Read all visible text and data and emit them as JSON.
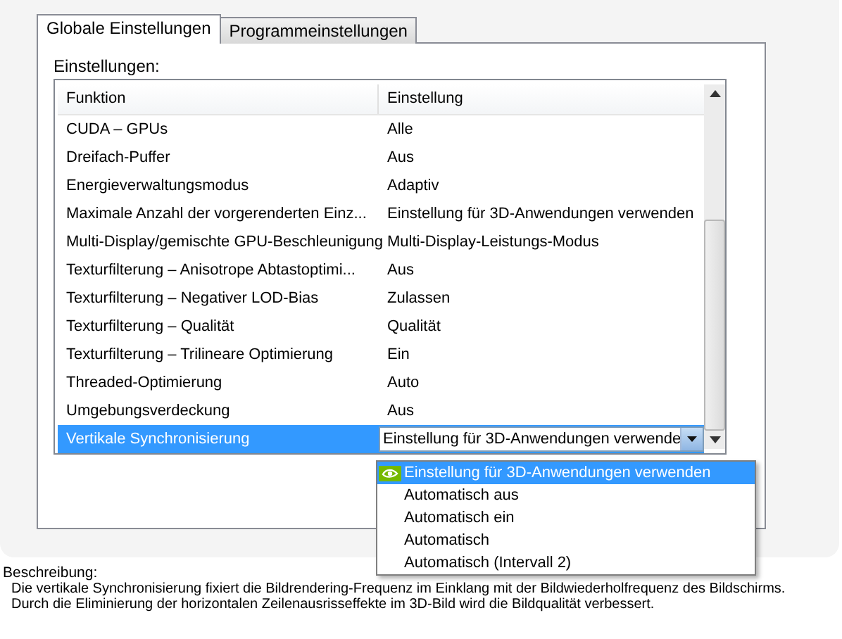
{
  "tabs": [
    {
      "label": "Globale Einstellungen",
      "selected": true
    },
    {
      "label": "Programmeinstellungen",
      "selected": false
    }
  ],
  "settings_label": "Einstellungen:",
  "table": {
    "columns": [
      "Funktion",
      "Einstellung"
    ],
    "rows": [
      {
        "function": "CUDA – GPUs",
        "setting": "Alle",
        "selected": false
      },
      {
        "function": "Dreifach-Puffer",
        "setting": "Aus",
        "selected": false
      },
      {
        "function": "Energieverwaltungsmodus",
        "setting": "Adaptiv",
        "selected": false
      },
      {
        "function": "Maximale Anzahl der vorgerenderten Einz...",
        "setting": "Einstellung für 3D-Anwendungen verwenden",
        "selected": false
      },
      {
        "function": "Multi-Display/gemischte GPU-Beschleunigung",
        "setting": "Multi-Display-Leistungs-Modus",
        "selected": false
      },
      {
        "function": "Texturfilterung – Anisotrope Abtastoptimi...",
        "setting": "Aus",
        "selected": false
      },
      {
        "function": "Texturfilterung – Negativer LOD-Bias",
        "setting": "Zulassen",
        "selected": false
      },
      {
        "function": "Texturfilterung – Qualität",
        "setting": "Qualität",
        "selected": false
      },
      {
        "function": "Texturfilterung – Trilineare Optimierung",
        "setting": "Ein",
        "selected": false
      },
      {
        "function": "Threaded-Optimierung",
        "setting": "Auto",
        "selected": false
      },
      {
        "function": "Umgebungsverdeckung",
        "setting": "Aus",
        "selected": false
      },
      {
        "function": "Vertikale Synchronisierung",
        "setting": "Einstellung für 3D-Anwendungen verwende",
        "selected": true
      }
    ]
  },
  "dropdown": {
    "expanded": true,
    "options": [
      {
        "label": "Einstellung für 3D-Anwendungen verwenden",
        "selected": true,
        "recommended": true
      },
      {
        "label": "Automatisch aus",
        "selected": false,
        "recommended": false
      },
      {
        "label": "Automatisch ein",
        "selected": false,
        "recommended": false
      },
      {
        "label": "Automatisch",
        "selected": false,
        "recommended": false
      },
      {
        "label": "Automatisch (Intervall 2)",
        "selected": false,
        "recommended": false
      }
    ]
  },
  "description": {
    "label": "Beschreibung:",
    "lines": [
      "Die vertikale Synchronisierung fixiert die Bildrendering-Frequenz im Einklang mit der Bildwiederholfrequenz des Bildschirms.",
      "Durch die Eliminierung der horizontalen Zeilenausrisseffekte im 3D-Bild wird die Bildqualität verbessert."
    ]
  }
}
